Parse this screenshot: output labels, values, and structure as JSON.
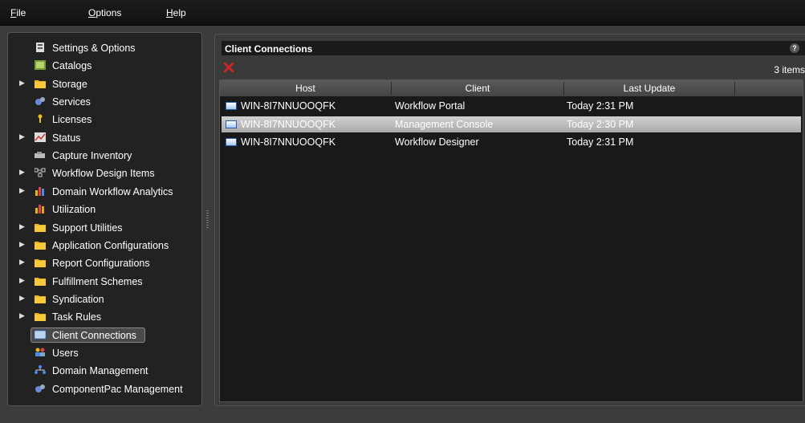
{
  "menu": [
    {
      "key": "F",
      "rest": "ile"
    },
    {
      "key": "O",
      "rest": "ptions"
    },
    {
      "key": "H",
      "rest": "elp"
    }
  ],
  "sidebar": {
    "items": [
      {
        "label": "Settings & Options",
        "icon": "settings-icon",
        "expandable": false
      },
      {
        "label": "Catalogs",
        "icon": "catalogs-icon",
        "expandable": false
      },
      {
        "label": "Storage",
        "icon": "folder-icon",
        "expandable": true
      },
      {
        "label": "Services",
        "icon": "services-icon",
        "expandable": false
      },
      {
        "label": "Licenses",
        "icon": "key-icon",
        "expandable": false
      },
      {
        "label": "Status",
        "icon": "status-chart-icon",
        "expandable": true
      },
      {
        "label": "Capture Inventory",
        "icon": "capture-icon",
        "expandable": false
      },
      {
        "label": "Workflow Design Items",
        "icon": "workflow-icon",
        "expandable": true
      },
      {
        "label": "Domain Workflow Analytics",
        "icon": "analytics-icon",
        "expandable": true
      },
      {
        "label": "Utilization",
        "icon": "utilization-icon",
        "expandable": false
      },
      {
        "label": "Support Utilities",
        "icon": "folder-icon",
        "expandable": true
      },
      {
        "label": "Application Configurations",
        "icon": "folder-icon",
        "expandable": true
      },
      {
        "label": "Report Configurations",
        "icon": "folder-icon",
        "expandable": true
      },
      {
        "label": "Fulfillment Schemes",
        "icon": "folder-icon",
        "expandable": true
      },
      {
        "label": "Syndication",
        "icon": "folder-icon",
        "expandable": true
      },
      {
        "label": "Task Rules",
        "icon": "folder-icon",
        "expandable": true
      },
      {
        "label": "Client Connections",
        "icon": "monitor-icon",
        "expandable": false,
        "selected": true
      },
      {
        "label": "Users",
        "icon": "users-icon",
        "expandable": false
      },
      {
        "label": "Domain Management",
        "icon": "domain-icon",
        "expandable": false
      },
      {
        "label": "ComponentPac Management",
        "icon": "componentpac-icon",
        "expandable": false
      }
    ]
  },
  "main": {
    "title": "Client Connections",
    "help": "?",
    "item_count": "3 items",
    "columns": [
      "Host",
      "Client",
      "Last Update"
    ],
    "rows": [
      {
        "host": "WIN-8I7NNUOOQFK",
        "client": "Workflow Portal",
        "updated": "Today 2:31 PM",
        "selected": false
      },
      {
        "host": "WIN-8I7NNUOOQFK",
        "client": "Management Console",
        "updated": "Today 2:30 PM",
        "selected": true
      },
      {
        "host": "WIN-8I7NNUOOQFK",
        "client": "Workflow Designer",
        "updated": "Today 2:31 PM",
        "selected": false
      }
    ]
  },
  "colors": {
    "folder": "#e8b520",
    "delete": "#d22",
    "selection": "#bdbdbd"
  }
}
